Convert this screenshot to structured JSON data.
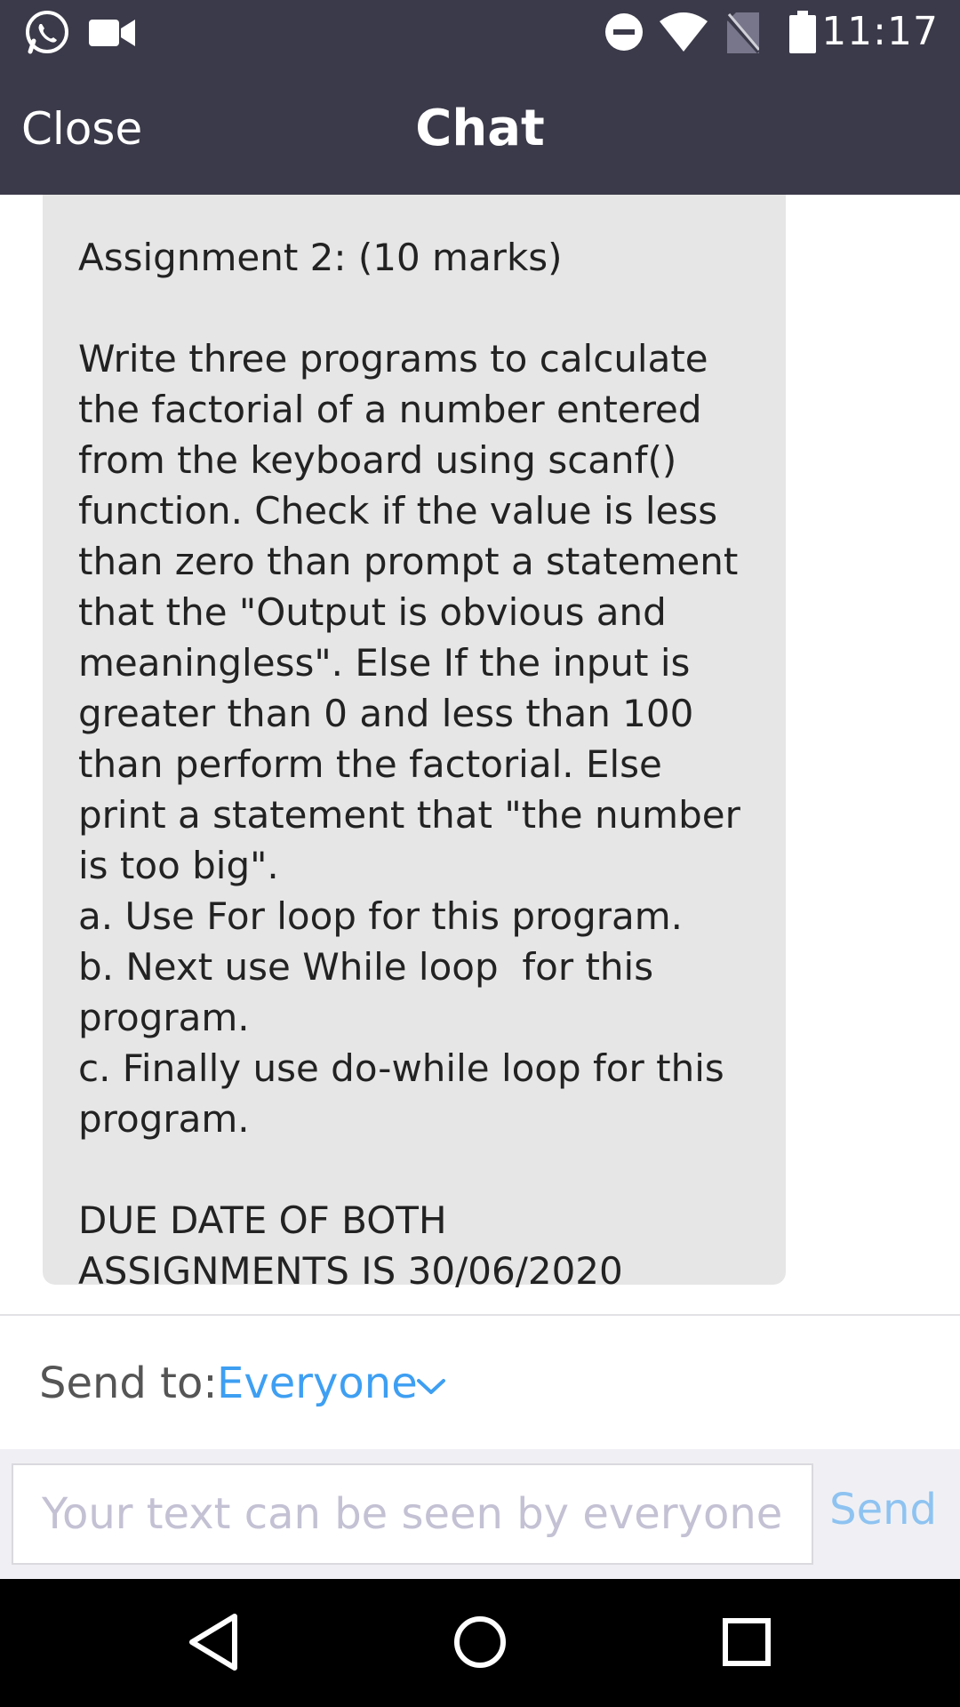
{
  "status_bar": {
    "time": "11:17",
    "left_icons": [
      "whatsapp-icon",
      "video-camera-icon"
    ],
    "right_icons": [
      "do-not-disturb-icon",
      "wifi-icon",
      "no-sim-icon",
      "battery-icon"
    ]
  },
  "header": {
    "close_label": "Close",
    "title": "Chat"
  },
  "chat": {
    "message_text": "Assignment 2: (10 marks)\n\nWrite three programs to calculate\nthe factorial of a number entered\nfrom the keyboard using scanf()\nfunction. Check if the value is less\nthan zero than prompt a statement\nthat the \"Output is obvious and\nmeaningless\". Else If the input is\ngreater than 0 and less than 100\nthan perform the factorial. Else\nprint a statement that \"the number\nis too big\".\na. Use For loop for this program.\nb. Next use While loop  for this\nprogram.\nc. Finally use do-while loop for this\nprogram.\n\nDUE DATE OF BOTH\nASSIGNMENTS IS 30/06/2020"
  },
  "send_to": {
    "label": "Send to: ",
    "value": "Everyone",
    "dropdown_icon": "chevron-down-icon"
  },
  "composer": {
    "placeholder": "Your text can be seen by everyone",
    "value": "",
    "send_label": "Send"
  },
  "nav_bar": {
    "icons": [
      "back-icon",
      "home-icon",
      "recents-icon"
    ]
  },
  "colors": {
    "header_bg": "#3b3a4a",
    "bubble_bg": "#e6e6e6",
    "accent": "#3e9ff2",
    "send_disabled": "#8ec3f1",
    "placeholder": "#c3c1d3"
  }
}
